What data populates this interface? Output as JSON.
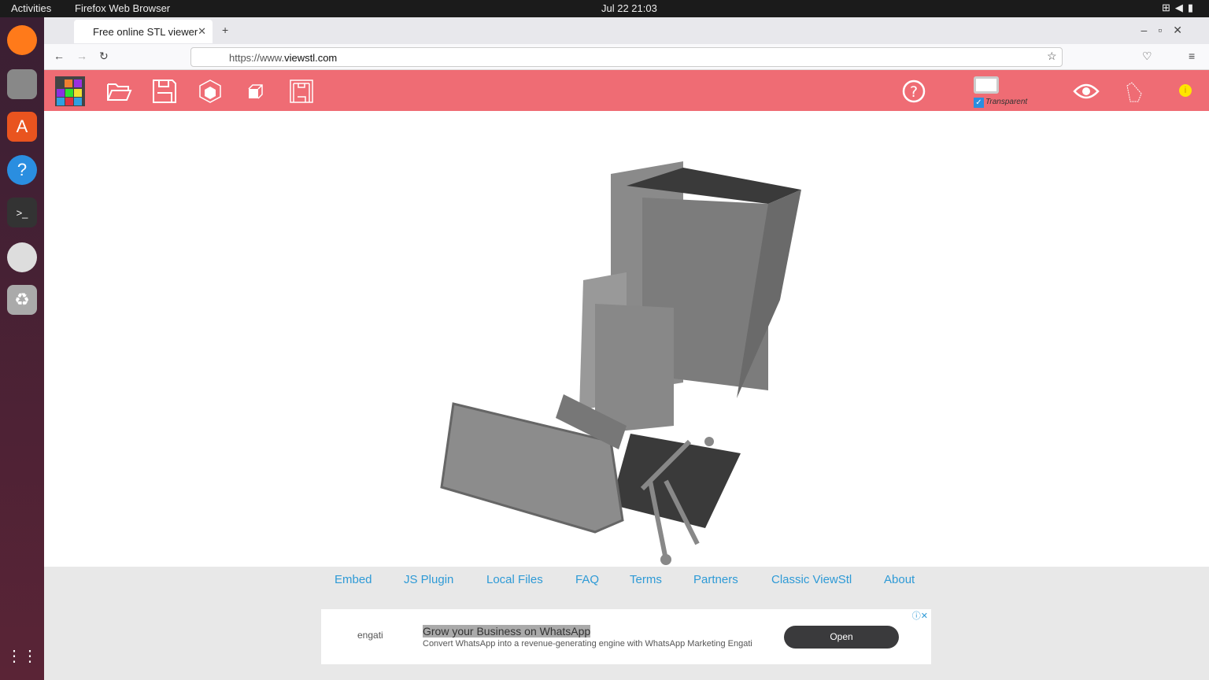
{
  "system": {
    "activities": "Activities",
    "app_name": "Firefox Web Browser",
    "clock": "Jul 22  21:03"
  },
  "browser": {
    "tab_title": "Free online STL viewer",
    "url_prefix": "https://www.",
    "url_domain": "viewstl.com"
  },
  "toolbar": {
    "transparent_label": "Transparent",
    "transparent_checked": true,
    "accent": "#ef6c74"
  },
  "footer": {
    "links": [
      "Embed",
      "JS Plugin",
      "Local Files",
      "FAQ",
      "Terms",
      "Partners",
      "Classic ViewStl",
      "About"
    ]
  },
  "ad": {
    "brand": "engati",
    "title": "Grow your Business on WhatsApp",
    "description": "Convert WhatsApp into a revenue-generating engine with WhatsApp Marketing Engati",
    "button": "Open"
  }
}
